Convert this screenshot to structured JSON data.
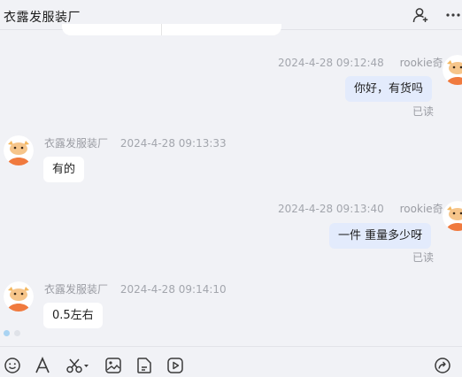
{
  "header": {
    "title": "衣露发服装厂",
    "add_user_icon": "add-user-icon",
    "more_icon": "more-icon"
  },
  "messages": [
    {
      "direction": "out",
      "timestamp": "2024-4-28 09:12:48",
      "sender": "rookie奇",
      "text": "你好，有货吗",
      "status": "已读"
    },
    {
      "direction": "in",
      "timestamp": "2024-4-28 09:13:33",
      "sender": "衣露发服装厂",
      "text": "有的"
    },
    {
      "direction": "out",
      "timestamp": "2024-4-28 09:13:40",
      "sender": "rookie奇",
      "text": "一件 重量多少呀",
      "status": "已读"
    },
    {
      "direction": "in",
      "timestamp": "2024-4-28 09:14:10",
      "sender": "衣露发服装厂",
      "text": "0.5左右"
    }
  ],
  "toolbar": {
    "icons": [
      "emoji-icon",
      "font-icon",
      "scissors-icon",
      "image-icon",
      "file-icon",
      "video-icon",
      "share-icon"
    ]
  },
  "colors": {
    "background": "#f1f2f6",
    "bubble_in": "#ffffff",
    "bubble_out": "#e3ebfc",
    "meta_text": "#a3a6ad",
    "avatar_orange": "#f07a3e"
  }
}
